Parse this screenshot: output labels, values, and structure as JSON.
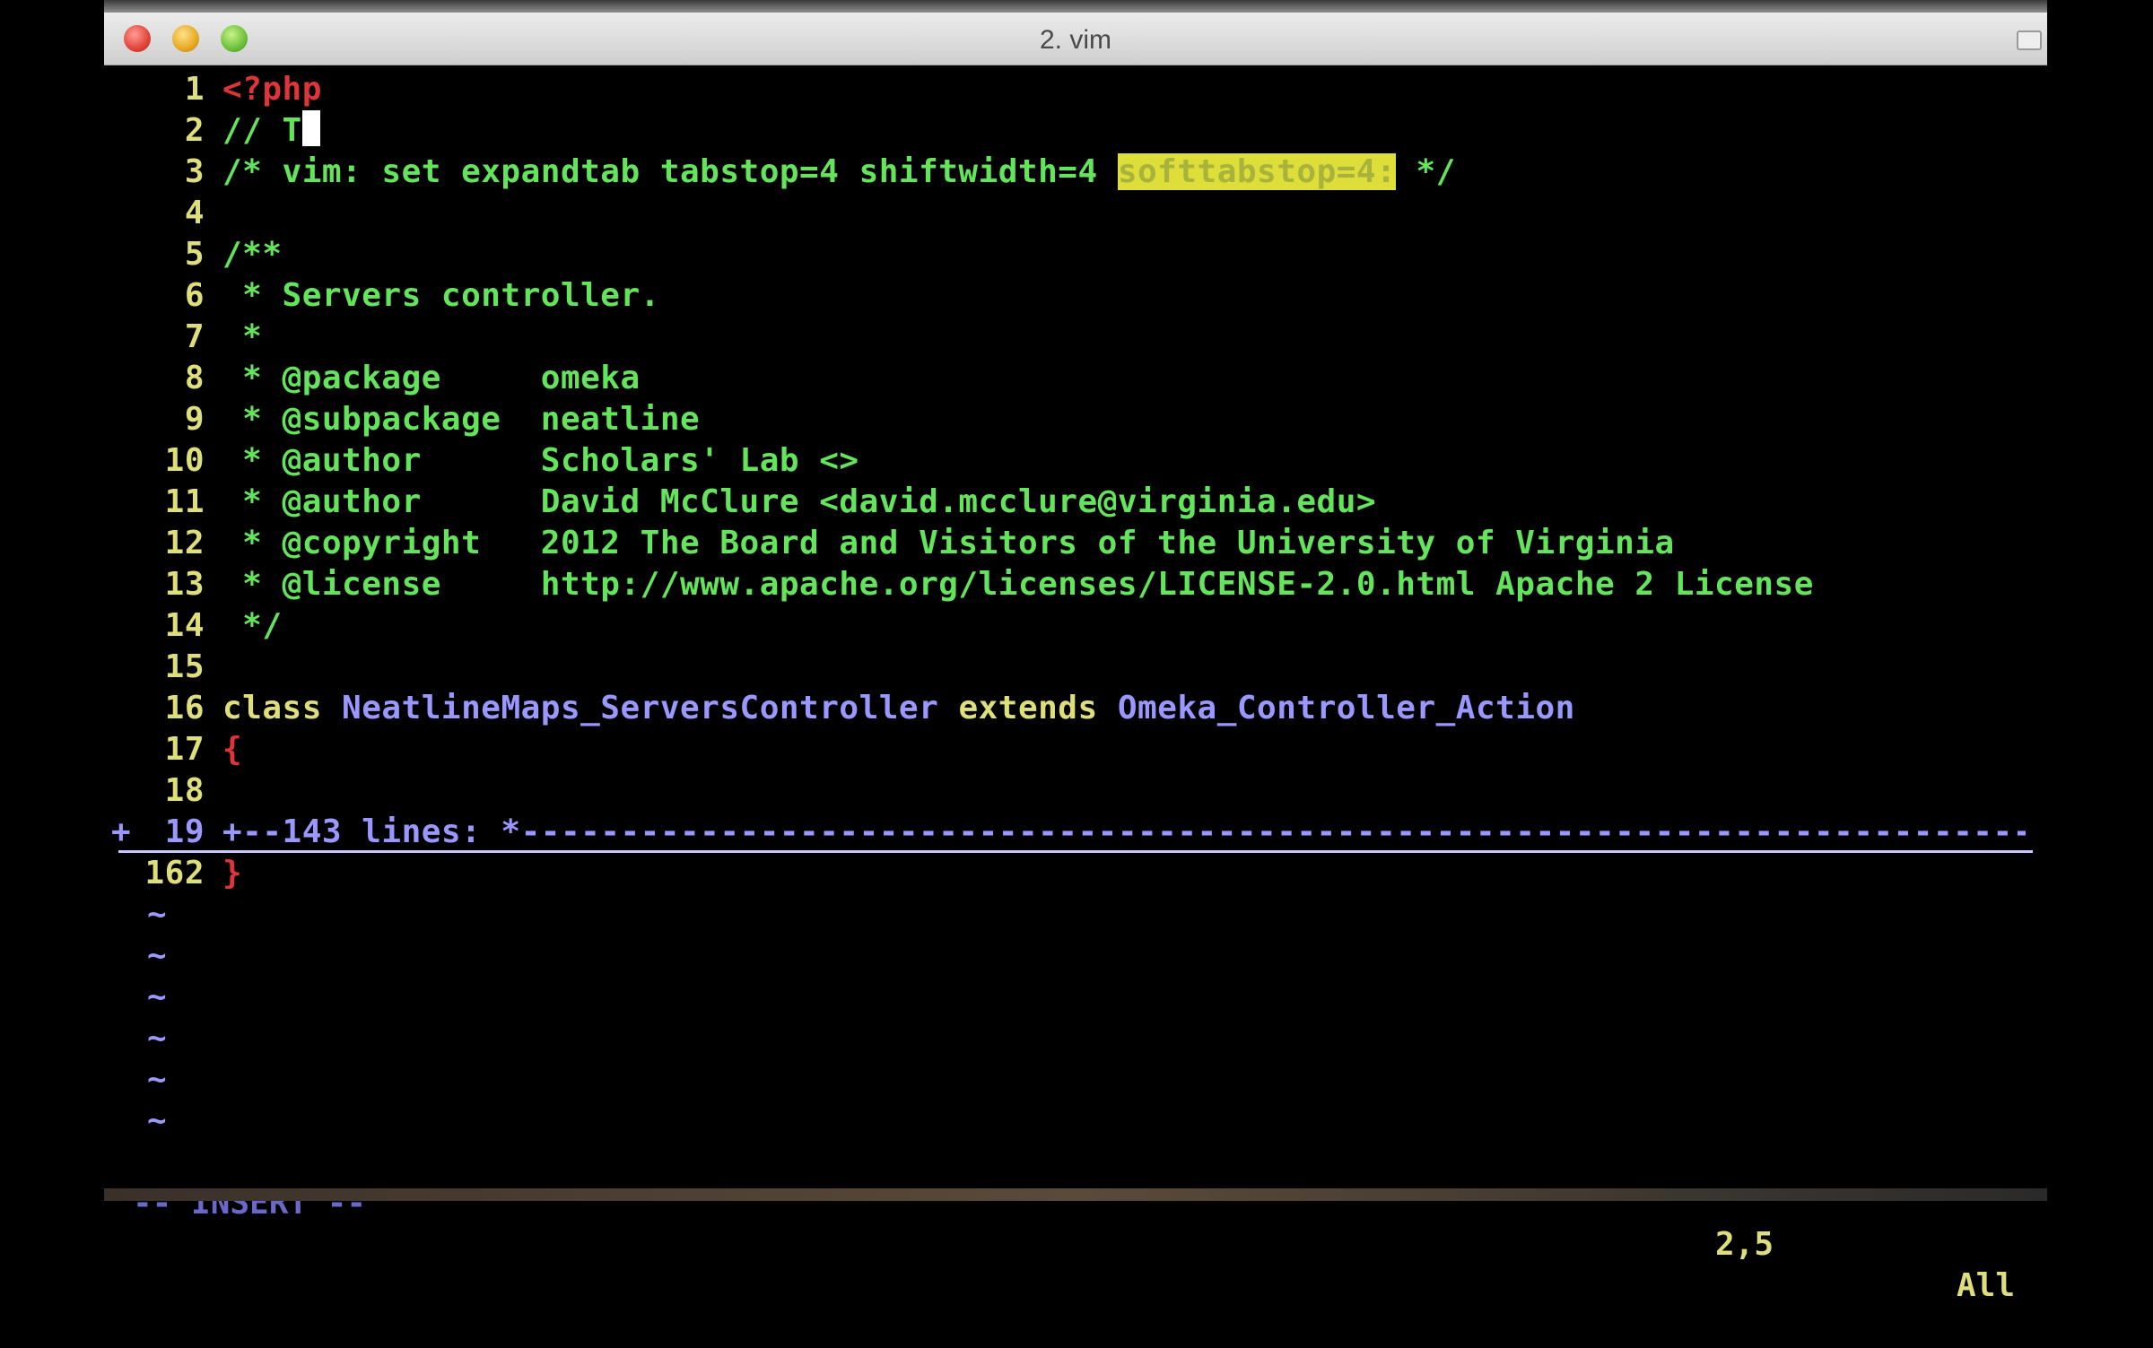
{
  "window": {
    "title": "2. vim",
    "controls": [
      "close-icon",
      "minimize-icon",
      "zoom-icon"
    ]
  },
  "colors": {
    "background": "#000000",
    "line_number": "#dede7a",
    "comment": "#63e45b",
    "keyword": "#dede7a",
    "class_name": "#9a98ff",
    "php_tag": "#e0343b",
    "search_highlight_bg": "#dede3a",
    "fold": "#9a98ff"
  },
  "editor": {
    "lines": [
      {
        "num": "1",
        "segments": [
          {
            "text": "<?php",
            "color": "#e0343b"
          }
        ]
      },
      {
        "num": "2",
        "segments": [
          {
            "text": "// T",
            "color": "#63e45b"
          }
        ],
        "cursor": true
      },
      {
        "num": "3",
        "segments": [
          {
            "text": "/* vim: set expandtab tabstop=4 shiftwidth=4 ",
            "color": "#63e45b"
          },
          {
            "text": "softtabstop=4:",
            "color": "#a7b33a",
            "highlight": true
          },
          {
            "text": " */",
            "color": "#63e45b"
          }
        ]
      },
      {
        "num": "4",
        "segments": []
      },
      {
        "num": "5",
        "segments": [
          {
            "text": "/**",
            "color": "#63e45b"
          }
        ]
      },
      {
        "num": "6",
        "segments": [
          {
            "text": " * Servers controller.",
            "color": "#63e45b"
          }
        ]
      },
      {
        "num": "7",
        "segments": [
          {
            "text": " *",
            "color": "#63e45b"
          }
        ]
      },
      {
        "num": "8",
        "segments": [
          {
            "text": " * @package     omeka",
            "color": "#63e45b"
          }
        ]
      },
      {
        "num": "9",
        "segments": [
          {
            "text": " * @subpackage  neatline",
            "color": "#63e45b"
          }
        ]
      },
      {
        "num": "10",
        "segments": [
          {
            "text": " * @author      Scholars' Lab <>",
            "color": "#63e45b"
          }
        ]
      },
      {
        "num": "11",
        "segments": [
          {
            "text": " * @author      David McClure <david.mcclure@virginia.edu>",
            "color": "#63e45b"
          }
        ]
      },
      {
        "num": "12",
        "segments": [
          {
            "text": " * @copyright   2012 The Board and Visitors of the University of Virginia",
            "color": "#63e45b"
          }
        ]
      },
      {
        "num": "13",
        "segments": [
          {
            "text": " * @license     http://www.apache.org/licenses/LICENSE-2.0.html Apache 2 License",
            "color": "#63e45b"
          }
        ]
      },
      {
        "num": "14",
        "segments": [
          {
            "text": " */",
            "color": "#63e45b"
          }
        ]
      },
      {
        "num": "15",
        "segments": []
      },
      {
        "num": "16",
        "segments": [
          {
            "text": "class ",
            "color": "#dede7a"
          },
          {
            "text": "NeatlineMaps_ServersController",
            "color": "#9a98ff"
          },
          {
            "text": " extends ",
            "color": "#dede7a"
          },
          {
            "text": "Omeka_Controller_Action",
            "color": "#9a98ff"
          }
        ]
      },
      {
        "num": "17",
        "segments": [
          {
            "text": "{",
            "color": "#e0343b"
          }
        ]
      },
      {
        "num": "18",
        "segments": []
      }
    ],
    "fold": {
      "sign": "+",
      "num": "19",
      "text": "+--143 lines: *-----------------------------------------------------------------------------------------"
    },
    "after_fold": [
      {
        "num": "162",
        "segments": [
          {
            "text": "}",
            "color": "#e0343b"
          }
        ]
      }
    ],
    "tildes": [
      "~",
      "~",
      "~",
      "~",
      "~",
      "~"
    ]
  },
  "statusline": {
    "mode": "-- INSERT --",
    "cursor_position": "2,5",
    "scroll_position": "All"
  }
}
